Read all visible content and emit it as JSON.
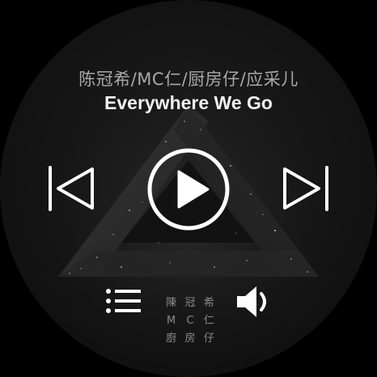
{
  "now_playing": {
    "artist": "陈冠希/MC仁/厨房仔/应采儿",
    "title": "Everywhere We Go"
  },
  "controls": {
    "previous_icon": "skip-previous-icon",
    "play_icon": "play-circle-icon",
    "next_icon": "skip-next-icon",
    "playlist_icon": "list-icon",
    "volume_icon": "volume-icon"
  },
  "album_stamp": {
    "chars": [
      "陳",
      "冠",
      "希",
      "M",
      "C",
      "仁",
      "廚",
      "房",
      "仔"
    ]
  },
  "colors": {
    "background": "#141414",
    "artist_text": "#a9a9a9",
    "title_text": "#f2f2f2",
    "icon": "#ffffff"
  }
}
